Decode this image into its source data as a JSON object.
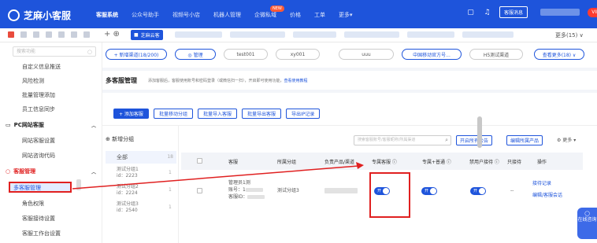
{
  "brand": {
    "name": "芝麻小客服"
  },
  "nav": {
    "items": [
      "客服系统",
      "公众号助手",
      "视频号小店",
      "机器人管理",
      "企微私域",
      "价格",
      "工单",
      "更多▾"
    ],
    "badge": "NEW"
  },
  "topbar": {
    "service_button": "客服消息",
    "avatar_label": "VIP"
  },
  "tabs": {
    "active_label": "芝麻云客",
    "more": "更多(15) ∨"
  },
  "sidebar": {
    "search_placeholder": "搜索功能",
    "items_top": [
      "自定义信息推送",
      "风险检测",
      "批量管理添加",
      "员工信息同步"
    ],
    "group_pc": "PC网站客服",
    "items_pc": [
      "网站客服设置",
      "网站咨询代码"
    ],
    "group_service": "客服管理",
    "active_item": "多客服管理",
    "items_service": [
      "角色权限",
      "客服接待设置",
      "客服工作台设置"
    ]
  },
  "filterbar": {
    "chips": [
      "+ 新增渠道(18/200)",
      "◎ 管理",
      "test001",
      "xy001",
      "uuu",
      "中国移动官方号...",
      "H5测试渠道",
      "查看更多(18) ∨"
    ]
  },
  "notice": {
    "title": "多客服管理",
    "desc": "添加客服后，客服使用账号和密码登录（或微信扫一扫），开启即可使用功能，",
    "link": "查看使用教程"
  },
  "buttons": {
    "add": "+ 添加客服",
    "batch_move": "批量移动分组",
    "batch_import": "批量导入客服",
    "batch_export": "批量导出客服",
    "export_ip": "导出IP记录"
  },
  "groups": {
    "add": "⊕ 新增分组",
    "all": "全部",
    "all_count": "18",
    "items": [
      {
        "name": "测试分组1",
        "id": "id：2223",
        "count": "1"
      },
      {
        "name": "测试分组2",
        "id": "id：2224",
        "count": "1"
      },
      {
        "name": "测试分组3",
        "id": "id：2540",
        "count": "1"
      }
    ]
  },
  "toolbar": {
    "search_placeholder": "搜索客服账号/客服昵称/所属渠道",
    "open_public": "开启所有公告",
    "edit_product": "编辑所属产品",
    "more": "⚙ 更多 ▾"
  },
  "table": {
    "headers": [
      "客服",
      "所属分组",
      "负责产品/渠道",
      "专属客服 ⓘ",
      "专属+普通 ⓘ",
      "禁用户接待 ⓘ",
      "只接待",
      "操作"
    ],
    "row": {
      "name": "管理员1测",
      "account": "账号：1",
      "cs_id": "客服ID：",
      "group": "测试分组3",
      "toggle_label": "开",
      "only_receive": "--",
      "actions": [
        "接待记录",
        "编辑/客服会话"
      ]
    }
  },
  "float_widget": {
    "label": "在线咨询"
  }
}
